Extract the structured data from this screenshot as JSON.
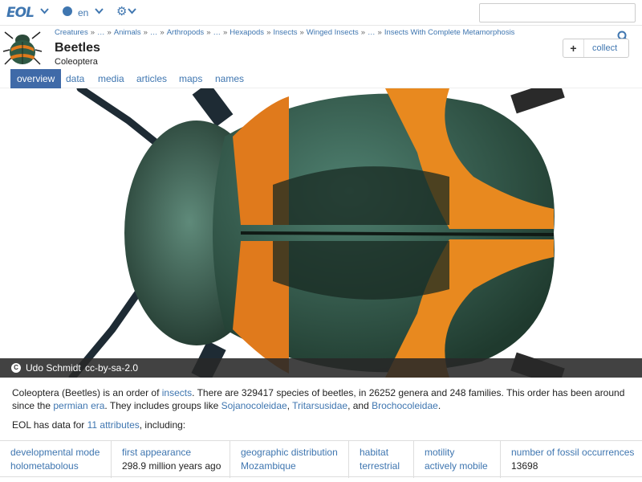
{
  "nav": {
    "logo": "EOL",
    "language": "en"
  },
  "breadcrumb": {
    "items": [
      "Creatures",
      "…",
      "Animals",
      "…",
      "Arthropods",
      "…",
      "Hexapods",
      "Insects",
      "Winged Insects",
      "…",
      "Insects With Complete Metamorphosis"
    ]
  },
  "page": {
    "title": "Beetles",
    "subtitle": "Coleoptera",
    "collect_label": "collect"
  },
  "tabs": [
    "overview",
    "data",
    "media",
    "articles",
    "maps",
    "names"
  ],
  "image_credit": {
    "author": "Udo Schmidt",
    "license": "cc-by-sa-2.0"
  },
  "description": {
    "p1": "Coleoptera (Beetles) is an order of ",
    "link_insects": "insects",
    "p2": ". There are 329417 species of beetles, in 26252 genera and 248 families. This order has been around since the ",
    "link_era": "permian era",
    "p3": ". They includes groups like ",
    "link_g1": "Sojanocoleidae",
    "sep1": ", ",
    "link_g2": "Tritarsusidae",
    "sep2": ", and ",
    "link_g3": "Brochocoleidae",
    "p4": "."
  },
  "eol_data": {
    "prefix": "EOL has data for ",
    "link": "11 attributes",
    "suffix": ", including:"
  },
  "attributes": [
    {
      "name": "developmental mode",
      "value": "holometabolous"
    },
    {
      "name": "first appearance",
      "value": "298.9 million years ago"
    },
    {
      "name": "geographic distribution",
      "value": "Mozambique"
    },
    {
      "name": "habitat",
      "value": "terrestrial"
    },
    {
      "name": "motility",
      "value": "actively mobile"
    },
    {
      "name": "number of fossil occurrences",
      "value": "13698"
    }
  ],
  "colors": {
    "link": "#3f76b0",
    "active_tab": "#3f6aa8",
    "beetle_orange": "#e07a1c",
    "beetle_green": "#2f5a45"
  },
  "icons": [
    "chevron-down-icon",
    "globe-icon",
    "gear-icon",
    "search-icon",
    "plus-icon",
    "creative-commons-icon"
  ]
}
